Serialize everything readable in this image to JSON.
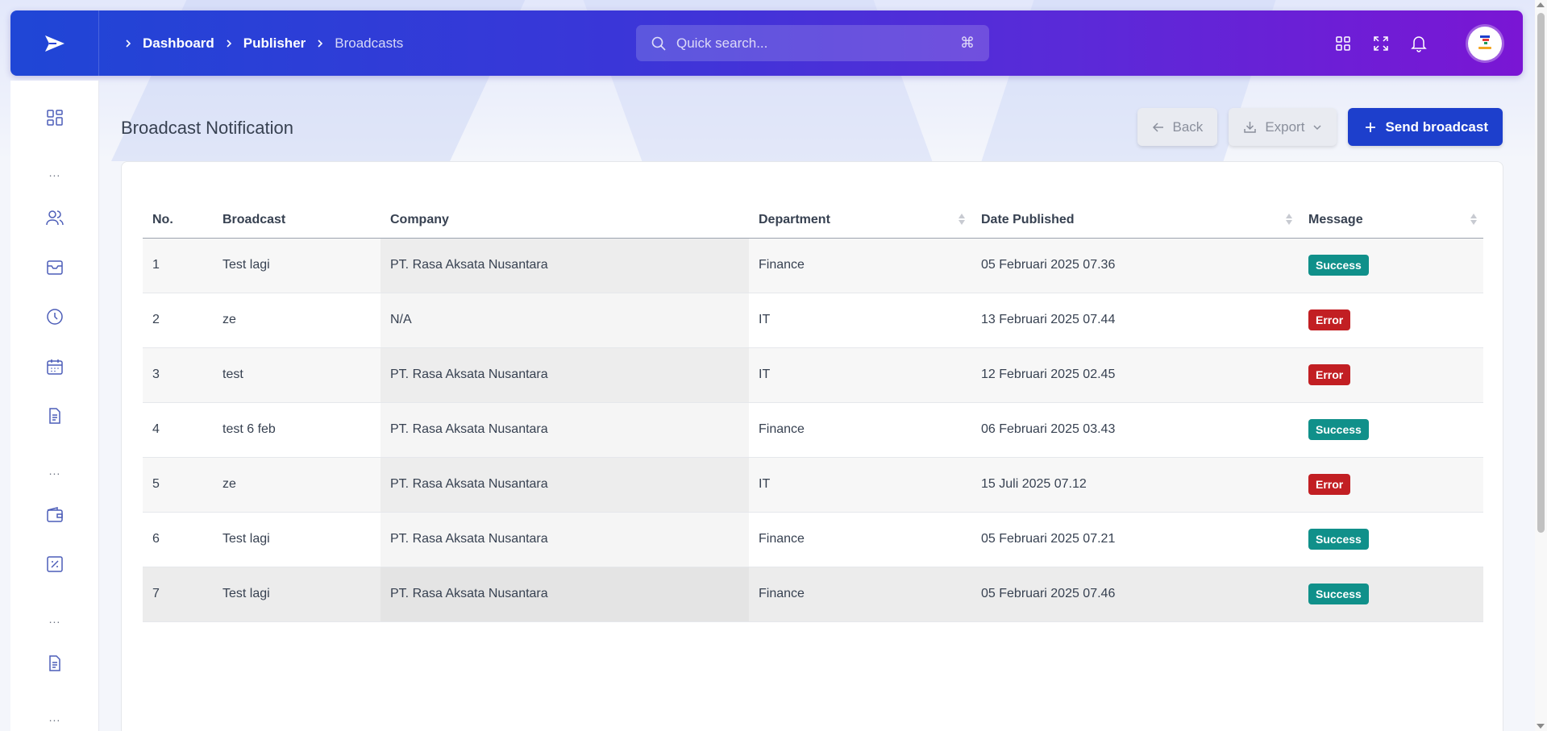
{
  "breadcrumb": [
    "Dashboard",
    "Publisher",
    "Broadcasts"
  ],
  "search": {
    "placeholder": "Quick search...",
    "shortcut": "⌘"
  },
  "page": {
    "title": "Broadcast Notification"
  },
  "actions": {
    "back": "Back",
    "export": "Export",
    "send": "Send broadcast"
  },
  "sidebar": {
    "dots": "..."
  },
  "table": {
    "headers": [
      "No.",
      "Broadcast",
      "Company",
      "Department",
      "Date Published",
      "Message"
    ],
    "rows": [
      {
        "no": "1",
        "broadcast": "Test lagi",
        "company": "PT. Rasa Aksata Nusantara",
        "department": "Finance",
        "date": "05 Februari 2025 07.36",
        "message": "Success"
      },
      {
        "no": "2",
        "broadcast": "ze",
        "company": "N/A",
        "department": "IT",
        "date": "13 Februari 2025 07.44",
        "message": "Error"
      },
      {
        "no": "3",
        "broadcast": "test",
        "company": "PT. Rasa Aksata Nusantara",
        "department": "IT",
        "date": "12 Februari 2025 02.45",
        "message": "Error"
      },
      {
        "no": "4",
        "broadcast": "test 6 feb",
        "company": "PT. Rasa Aksata Nusantara",
        "department": "Finance",
        "date": "06 Februari 2025 03.43",
        "message": "Success"
      },
      {
        "no": "5",
        "broadcast": "ze",
        "company": "PT. Rasa Aksata Nusantara",
        "department": "IT",
        "date": "15 Juli 2025 07.12",
        "message": "Error"
      },
      {
        "no": "6",
        "broadcast": "Test lagi",
        "company": "PT. Rasa Aksata Nusantara",
        "department": "Finance",
        "date": "05 Februari 2025 07.21",
        "message": "Success"
      },
      {
        "no": "7",
        "broadcast": "Test lagi",
        "company": "PT. Rasa Aksata Nusantara",
        "department": "Finance",
        "date": "05 Februari 2025 07.46",
        "message": "Success"
      }
    ]
  },
  "colors": {
    "success": "#10908a",
    "error": "#c21f23",
    "primary": "#1d3fcc"
  }
}
